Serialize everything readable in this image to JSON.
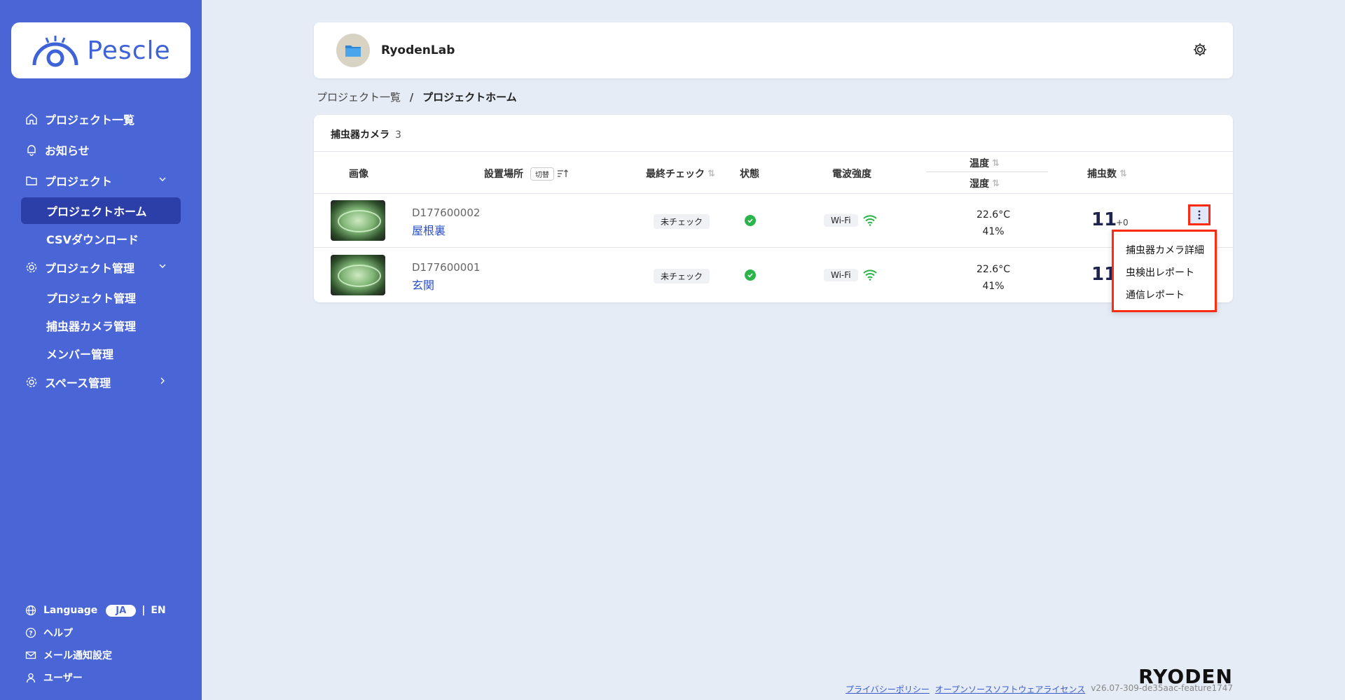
{
  "brand": {
    "logo_text": "Pescle",
    "accent": "#4a66d6",
    "active": "#2c3fa8",
    "highlight": "#ff2a12"
  },
  "sidebar": {
    "nav": {
      "project_list": "プロジェクト一覧",
      "news": "お知らせ",
      "project": "プロジェクト",
      "project_home": "プロジェクトホーム",
      "csv_download": "CSVダウンロード",
      "project_admin": "プロジェクト管理",
      "project_admin_sub": "プロジェクト管理",
      "camera_admin": "捕虫器カメラ管理",
      "member_admin": "メンバー管理",
      "space_admin": "スペース管理"
    },
    "bottom": {
      "language": "Language",
      "lang_ja": "JA",
      "lang_sep": "|",
      "lang_en": "EN",
      "help": "ヘルプ",
      "mail": "メール通知設定",
      "user": "ユーザー"
    }
  },
  "project_bar": {
    "name": "RyodenLab"
  },
  "breadcrumb": {
    "parent": "プロジェクト一覧",
    "sep": "/",
    "current": "プロジェクトホーム"
  },
  "table": {
    "title": "捕虫器カメラ",
    "count": "3",
    "headers": {
      "image": "画像",
      "location": "設置場所",
      "toggle": "切替",
      "last_check": "最終チェック",
      "status": "状態",
      "signal": "電波強度",
      "temperature": "温度",
      "humidity": "湿度",
      "catch_count": "捕虫数"
    },
    "rows": [
      {
        "device_id": "D177600002",
        "location": "屋根裏",
        "last_check": "未チェック",
        "signal": "Wi-Fi",
        "temperature": "22.6°C",
        "humidity": "41%",
        "count": "11",
        "delta": "+0"
      },
      {
        "device_id": "D177600001",
        "location": "玄関",
        "last_check": "未チェック",
        "signal": "Wi-Fi",
        "temperature": "22.6°C",
        "humidity": "41%",
        "count": "11",
        "delta": ""
      }
    ]
  },
  "dropdown": {
    "items": [
      "捕虫器カメラ詳細",
      "虫検出レポート",
      "通信レポート"
    ]
  },
  "footer": {
    "logo": "RYODEN",
    "privacy": "プライバシーポリシー",
    "oss": "オープンソースソフトウェアライセンス",
    "version": "v26.07-309-de35aac-feature1747"
  },
  "icons": [
    "home-icon",
    "bell-icon",
    "folder-icon",
    "gear-icon",
    "globe-icon",
    "help-icon",
    "mail-icon",
    "user-icon",
    "wifi-icon",
    "check-icon",
    "more-vertical-icon",
    "chevron-down-icon",
    "chevron-right-icon"
  ]
}
